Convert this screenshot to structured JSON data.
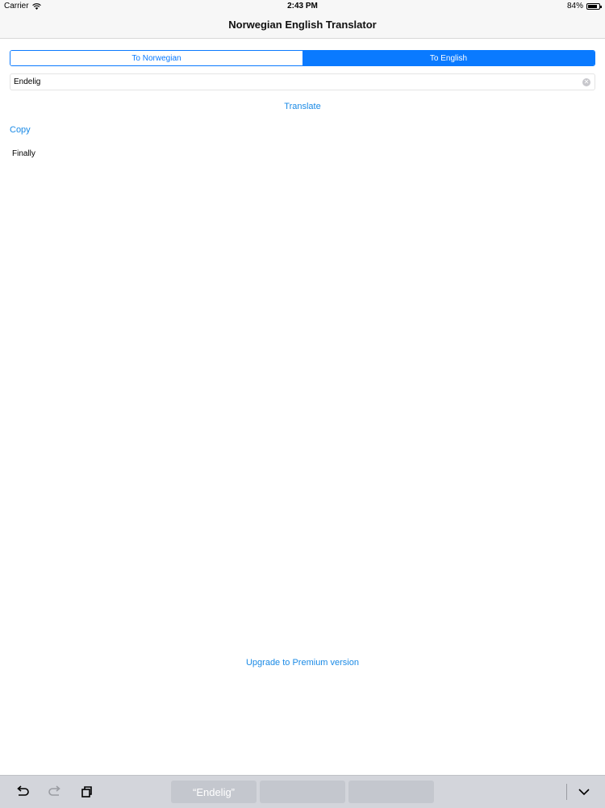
{
  "status_bar": {
    "carrier": "Carrier",
    "time": "2:43 PM",
    "battery": "84%",
    "battery_level": 0.84,
    "icons": {
      "signal": "wifi-icon",
      "battery": "battery-icon"
    }
  },
  "nav": {
    "title": "Norwegian English Translator"
  },
  "segments": [
    {
      "label": "To Norwegian",
      "selected": false
    },
    {
      "label": "To English",
      "selected": true
    }
  ],
  "search": {
    "value": "Endelig",
    "placeholder": ""
  },
  "actions": {
    "translate": "Translate",
    "copy": "Copy",
    "upgrade": "Upgrade to Premium version"
  },
  "result": {
    "text": "Finally"
  },
  "keyboard": {
    "suggestions": [
      "“Endelig”",
      "",
      ""
    ],
    "icons": [
      "undo-icon",
      "redo-icon",
      "paste-icon",
      "hide-keyboard-icon"
    ]
  },
  "colors": {
    "accent": "#0a7aff",
    "link": "#1a8ae6",
    "bar": "#f7f7f7",
    "keyboard": "#d3d5db"
  }
}
